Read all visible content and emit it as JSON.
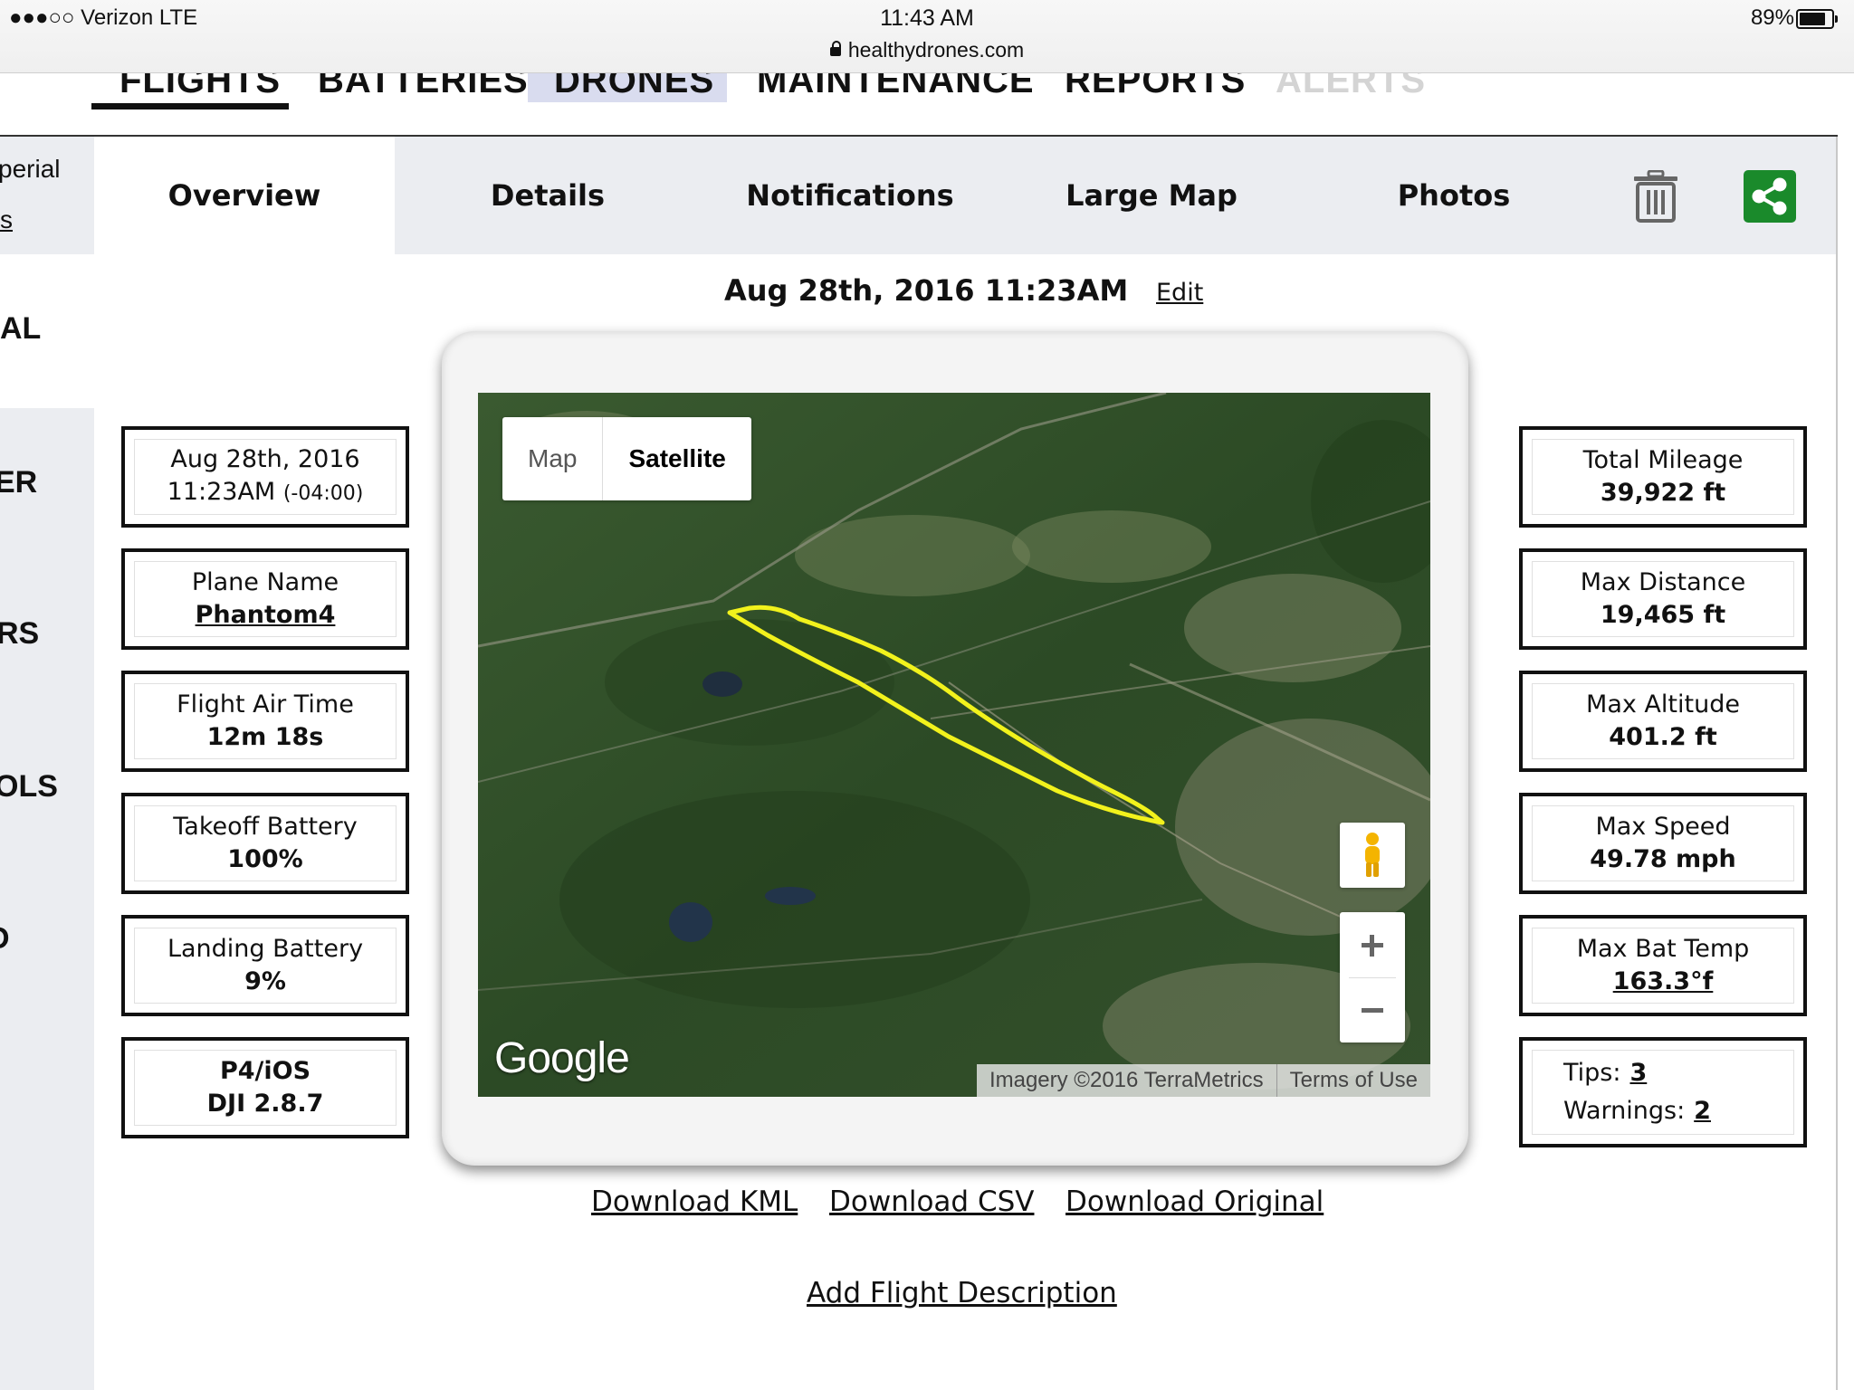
{
  "status_bar": {
    "carrier": "●●●○○ Verizon  LTE",
    "time": "11:43 AM",
    "url": "healthydrones.com",
    "battery_percent": "89%",
    "battery_level": 0.89
  },
  "top_nav": {
    "items": [
      "FLIGHTS",
      "BATTERIES",
      "DRONES",
      "MAINTENANCE",
      "REPORTS",
      "ALERTS"
    ],
    "active": "FLIGHTS"
  },
  "sidebar": {
    "fragments": [
      "perial",
      "s",
      "AL",
      "ER",
      "RS",
      "OLS",
      "D"
    ]
  },
  "tabs": {
    "items": [
      "Overview",
      "Details",
      "Notifications",
      "Large Map",
      "Photos"
    ],
    "active": "Overview",
    "icons": [
      "trash-icon",
      "share-icon"
    ],
    "share_color": "#1a8a2b"
  },
  "flight": {
    "heading": "Aug 28th, 2016 11:23AM",
    "edit_label": "Edit"
  },
  "left_stats": {
    "date": {
      "line1": "Aug 28th, 2016",
      "line2": "11:23AM",
      "tz": "(-04:00)"
    },
    "plane": {
      "label": "Plane Name",
      "value": "Phantom4"
    },
    "air_time": {
      "label": "Flight Air Time",
      "value": "12m 18s"
    },
    "takeoff_battery": {
      "label": "Takeoff Battery",
      "value": "100%"
    },
    "landing_battery": {
      "label": "Landing Battery",
      "value": "9%"
    },
    "app": {
      "line1": "P4/iOS",
      "line2": "DJI 2.8.7"
    }
  },
  "right_stats": {
    "total_mileage": {
      "label": "Total Mileage",
      "value": "39,922 ft"
    },
    "max_distance": {
      "label": "Max Distance",
      "value": "19,465 ft"
    },
    "max_altitude": {
      "label": "Max Altitude",
      "value": "401.2 ft"
    },
    "max_speed": {
      "label": "Max Speed",
      "value": "49.78 mph"
    },
    "max_bat_temp": {
      "label": "Max Bat Temp",
      "value": "163.3°f"
    },
    "tips": {
      "label": "Tips:",
      "value": "3"
    },
    "warnings": {
      "label": "Warnings:",
      "value": "2"
    }
  },
  "map": {
    "type_options": [
      "Map",
      "Satellite"
    ],
    "selected_type": "Satellite",
    "logo": "Google",
    "imagery_credit": "Imagery ©2016 TerraMetrics",
    "terms": "Terms of Use",
    "path_color": "#f2f21c",
    "controls": [
      "pegman-icon",
      "zoom-in-icon",
      "zoom-out-icon"
    ]
  },
  "downloads": [
    "Download KML",
    "Download CSV",
    "Download Original"
  ],
  "add_description": "Add Flight Description"
}
